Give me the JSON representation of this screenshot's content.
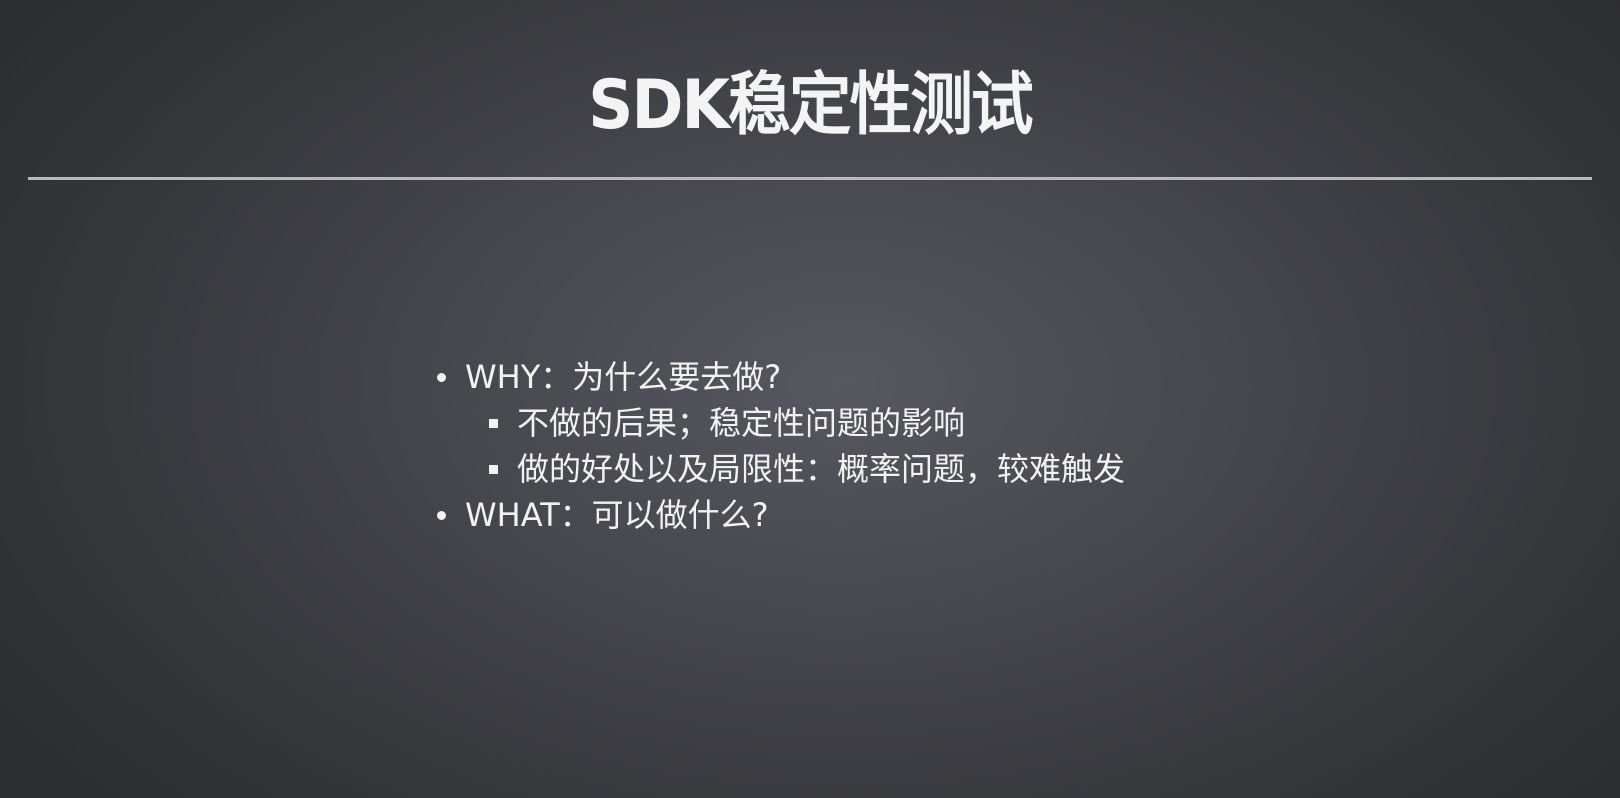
{
  "slide": {
    "title": "SDK稳定性测试",
    "bullets": [
      {
        "text": "WHY：为什么要去做?",
        "sub": [
          "不做的后果；稳定性问题的影响",
          "做的好处以及局限性：概率问题，较难触发"
        ]
      },
      {
        "text": "WHAT：可以做什么?"
      }
    ]
  },
  "colors": {
    "background_center": "#55585e",
    "background_edge": "#2d2e31",
    "text": "#f2f2f2",
    "rule": "#b9b9bb"
  },
  "icons": {
    "level1_bullet": "bullet-dot-icon",
    "level2_bullet": "bullet-square-icon"
  }
}
